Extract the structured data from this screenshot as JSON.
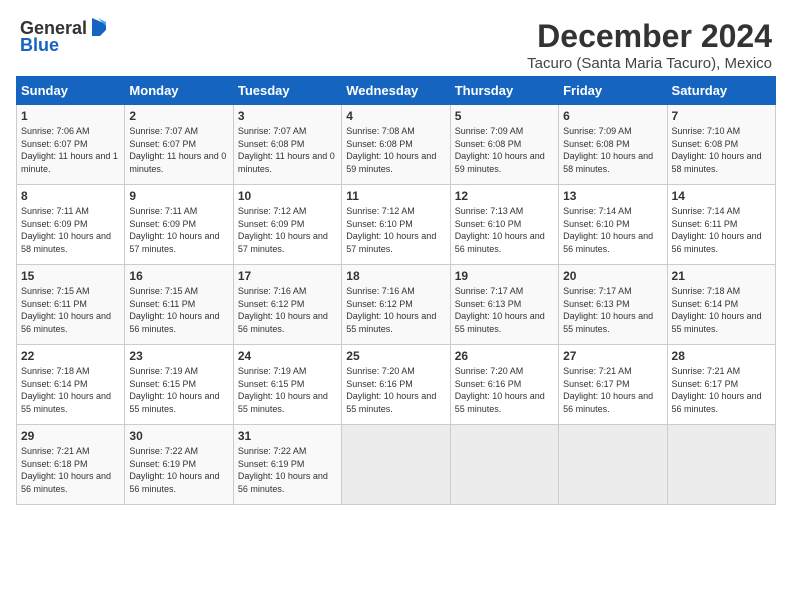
{
  "logo": {
    "general": "General",
    "blue": "Blue"
  },
  "header": {
    "month": "December 2024",
    "location": "Tacuro (Santa Maria Tacuro), Mexico"
  },
  "days_of_week": [
    "Sunday",
    "Monday",
    "Tuesday",
    "Wednesday",
    "Thursday",
    "Friday",
    "Saturday"
  ],
  "weeks": [
    [
      {
        "day": "1",
        "sunrise": "Sunrise: 7:06 AM",
        "sunset": "Sunset: 6:07 PM",
        "daylight": "Daylight: 11 hours and 1 minute."
      },
      {
        "day": "2",
        "sunrise": "Sunrise: 7:07 AM",
        "sunset": "Sunset: 6:07 PM",
        "daylight": "Daylight: 11 hours and 0 minutes."
      },
      {
        "day": "3",
        "sunrise": "Sunrise: 7:07 AM",
        "sunset": "Sunset: 6:08 PM",
        "daylight": "Daylight: 11 hours and 0 minutes."
      },
      {
        "day": "4",
        "sunrise": "Sunrise: 7:08 AM",
        "sunset": "Sunset: 6:08 PM",
        "daylight": "Daylight: 10 hours and 59 minutes."
      },
      {
        "day": "5",
        "sunrise": "Sunrise: 7:09 AM",
        "sunset": "Sunset: 6:08 PM",
        "daylight": "Daylight: 10 hours and 59 minutes."
      },
      {
        "day": "6",
        "sunrise": "Sunrise: 7:09 AM",
        "sunset": "Sunset: 6:08 PM",
        "daylight": "Daylight: 10 hours and 58 minutes."
      },
      {
        "day": "7",
        "sunrise": "Sunrise: 7:10 AM",
        "sunset": "Sunset: 6:08 PM",
        "daylight": "Daylight: 10 hours and 58 minutes."
      }
    ],
    [
      {
        "day": "8",
        "sunrise": "Sunrise: 7:11 AM",
        "sunset": "Sunset: 6:09 PM",
        "daylight": "Daylight: 10 hours and 58 minutes."
      },
      {
        "day": "9",
        "sunrise": "Sunrise: 7:11 AM",
        "sunset": "Sunset: 6:09 PM",
        "daylight": "Daylight: 10 hours and 57 minutes."
      },
      {
        "day": "10",
        "sunrise": "Sunrise: 7:12 AM",
        "sunset": "Sunset: 6:09 PM",
        "daylight": "Daylight: 10 hours and 57 minutes."
      },
      {
        "day": "11",
        "sunrise": "Sunrise: 7:12 AM",
        "sunset": "Sunset: 6:10 PM",
        "daylight": "Daylight: 10 hours and 57 minutes."
      },
      {
        "day": "12",
        "sunrise": "Sunrise: 7:13 AM",
        "sunset": "Sunset: 6:10 PM",
        "daylight": "Daylight: 10 hours and 56 minutes."
      },
      {
        "day": "13",
        "sunrise": "Sunrise: 7:14 AM",
        "sunset": "Sunset: 6:10 PM",
        "daylight": "Daylight: 10 hours and 56 minutes."
      },
      {
        "day": "14",
        "sunrise": "Sunrise: 7:14 AM",
        "sunset": "Sunset: 6:11 PM",
        "daylight": "Daylight: 10 hours and 56 minutes."
      }
    ],
    [
      {
        "day": "15",
        "sunrise": "Sunrise: 7:15 AM",
        "sunset": "Sunset: 6:11 PM",
        "daylight": "Daylight: 10 hours and 56 minutes."
      },
      {
        "day": "16",
        "sunrise": "Sunrise: 7:15 AM",
        "sunset": "Sunset: 6:11 PM",
        "daylight": "Daylight: 10 hours and 56 minutes."
      },
      {
        "day": "17",
        "sunrise": "Sunrise: 7:16 AM",
        "sunset": "Sunset: 6:12 PM",
        "daylight": "Daylight: 10 hours and 56 minutes."
      },
      {
        "day": "18",
        "sunrise": "Sunrise: 7:16 AM",
        "sunset": "Sunset: 6:12 PM",
        "daylight": "Daylight: 10 hours and 55 minutes."
      },
      {
        "day": "19",
        "sunrise": "Sunrise: 7:17 AM",
        "sunset": "Sunset: 6:13 PM",
        "daylight": "Daylight: 10 hours and 55 minutes."
      },
      {
        "day": "20",
        "sunrise": "Sunrise: 7:17 AM",
        "sunset": "Sunset: 6:13 PM",
        "daylight": "Daylight: 10 hours and 55 minutes."
      },
      {
        "day": "21",
        "sunrise": "Sunrise: 7:18 AM",
        "sunset": "Sunset: 6:14 PM",
        "daylight": "Daylight: 10 hours and 55 minutes."
      }
    ],
    [
      {
        "day": "22",
        "sunrise": "Sunrise: 7:18 AM",
        "sunset": "Sunset: 6:14 PM",
        "daylight": "Daylight: 10 hours and 55 minutes."
      },
      {
        "day": "23",
        "sunrise": "Sunrise: 7:19 AM",
        "sunset": "Sunset: 6:15 PM",
        "daylight": "Daylight: 10 hours and 55 minutes."
      },
      {
        "day": "24",
        "sunrise": "Sunrise: 7:19 AM",
        "sunset": "Sunset: 6:15 PM",
        "daylight": "Daylight: 10 hours and 55 minutes."
      },
      {
        "day": "25",
        "sunrise": "Sunrise: 7:20 AM",
        "sunset": "Sunset: 6:16 PM",
        "daylight": "Daylight: 10 hours and 55 minutes."
      },
      {
        "day": "26",
        "sunrise": "Sunrise: 7:20 AM",
        "sunset": "Sunset: 6:16 PM",
        "daylight": "Daylight: 10 hours and 55 minutes."
      },
      {
        "day": "27",
        "sunrise": "Sunrise: 7:21 AM",
        "sunset": "Sunset: 6:17 PM",
        "daylight": "Daylight: 10 hours and 56 minutes."
      },
      {
        "day": "28",
        "sunrise": "Sunrise: 7:21 AM",
        "sunset": "Sunset: 6:17 PM",
        "daylight": "Daylight: 10 hours and 56 minutes."
      }
    ],
    [
      {
        "day": "29",
        "sunrise": "Sunrise: 7:21 AM",
        "sunset": "Sunset: 6:18 PM",
        "daylight": "Daylight: 10 hours and 56 minutes."
      },
      {
        "day": "30",
        "sunrise": "Sunrise: 7:22 AM",
        "sunset": "Sunset: 6:19 PM",
        "daylight": "Daylight: 10 hours and 56 minutes."
      },
      {
        "day": "31",
        "sunrise": "Sunrise: 7:22 AM",
        "sunset": "Sunset: 6:19 PM",
        "daylight": "Daylight: 10 hours and 56 minutes."
      },
      null,
      null,
      null,
      null
    ]
  ]
}
